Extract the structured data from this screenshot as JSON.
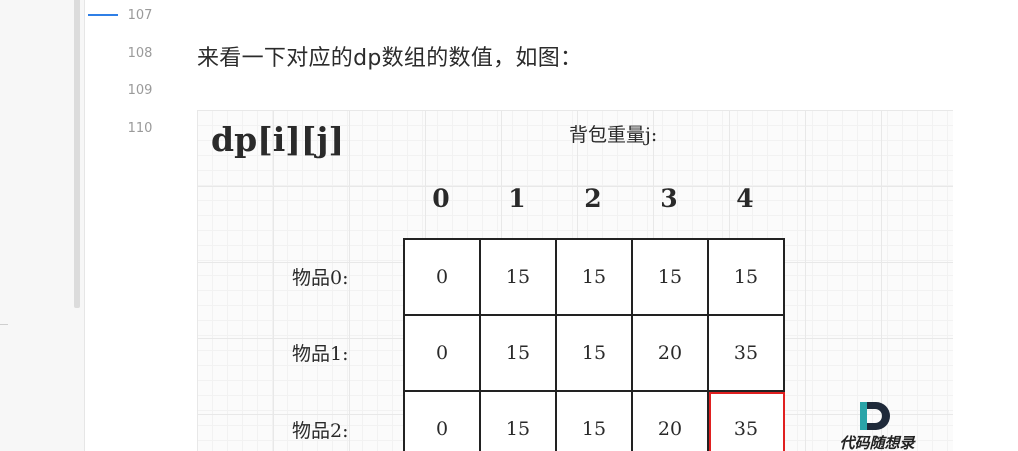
{
  "editor": {
    "line_numbers": [
      "107",
      "108",
      "109",
      "110"
    ],
    "paragraph": "来看一下对应的dp数组的数值，如图："
  },
  "figure": {
    "title": "dp[i][j]",
    "caption": "背包重量j:",
    "columns": [
      "0",
      "1",
      "2",
      "3",
      "4"
    ],
    "rows": [
      {
        "label": "物品0:",
        "values": [
          "0",
          "15",
          "15",
          "15",
          "15"
        ]
      },
      {
        "label": "物品1:",
        "values": [
          "0",
          "15",
          "15",
          "20",
          "35"
        ]
      },
      {
        "label": "物品2:",
        "values": [
          "0",
          "15",
          "15",
          "20",
          "35"
        ]
      }
    ],
    "highlight_color": "#e02020",
    "logo_text": "代码随想录"
  },
  "colors": {
    "accent": "#2f7fe6",
    "text": "#2b2b2b",
    "line_number": "#9a9a9a"
  }
}
